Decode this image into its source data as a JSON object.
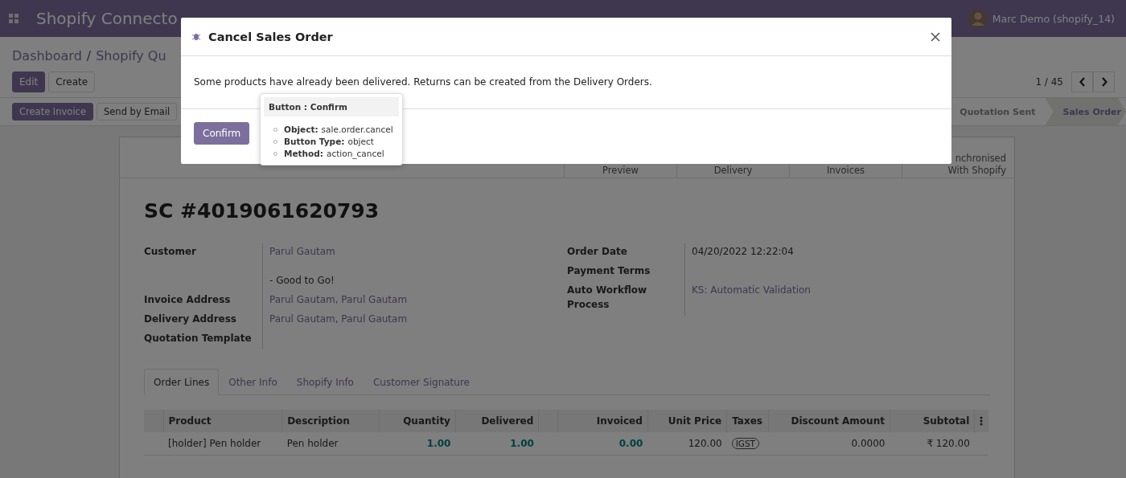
{
  "navbar": {
    "app_title": "Shopify Connecto",
    "user": "Marc Demo (shopify_14)"
  },
  "breadcrumb": {
    "separator": "/",
    "items": [
      {
        "label": "Dashboard"
      },
      {
        "label": "Shopify Qu"
      }
    ]
  },
  "control_buttons": [
    {
      "label": "Edit",
      "kind": "primary"
    },
    {
      "label": "Create",
      "kind": "secondary"
    }
  ],
  "pager": {
    "text": "1 / 45"
  },
  "action_buttons": [
    {
      "label": "Create Invoice",
      "kind": "primary"
    },
    {
      "label": "Send by Email",
      "kind": "secondary"
    }
  ],
  "status_steps": [
    {
      "label": "Quotation Sent",
      "selected": false
    },
    {
      "label": "Sales Order",
      "selected": true
    }
  ],
  "stat_buttons": [
    {
      "lines": [
        "Preview"
      ]
    },
    {
      "lines": [
        "Delivery"
      ]
    },
    {
      "lines": [
        "Invoices"
      ]
    },
    {
      "lines": [
        "nchronised",
        "With Shopify"
      ]
    }
  ],
  "record": {
    "title": "SC #4019061620793",
    "left_fields": [
      {
        "label": "Customer",
        "value": "Parul Gautam",
        "note": "- Good to Go!"
      },
      {
        "label": "Invoice Address",
        "value": "Parul Gautam, Parul Gautam"
      },
      {
        "label": "Delivery Address",
        "value": "Parul Gautam, Parul Gautam"
      },
      {
        "label": "Quotation Template"
      }
    ],
    "right_fields": [
      {
        "label": "Order Date",
        "value": "04/20/2022 12:22:04",
        "kind": "text"
      },
      {
        "label": "Payment Terms"
      },
      {
        "label": "Auto Workflow Process",
        "value": "KS: Automatic Validation",
        "kind": "link"
      }
    ]
  },
  "tabs": [
    {
      "label": "Order Lines",
      "selected": true
    },
    {
      "label": "Other Info",
      "selected": false
    },
    {
      "label": "Shopify Info",
      "selected": false
    },
    {
      "label": "Customer Signature",
      "selected": false
    }
  ],
  "table": {
    "columns": [
      {
        "kind": "handle"
      },
      {
        "label": "Product"
      },
      {
        "label": "Description"
      },
      {
        "label": "Quantity"
      },
      {
        "label": "Delivered"
      },
      {
        "kind": "blank"
      },
      {
        "label": "Invoiced"
      },
      {
        "label": "Unit Price"
      },
      {
        "label": "Taxes"
      },
      {
        "label": "Discount Amount"
      },
      {
        "label": "Subtotal"
      },
      {
        "kind": "menu"
      }
    ],
    "rows": [
      [
        {
          "kind": "blank"
        },
        {
          "text": "[holder] Pen holder",
          "kind": "text"
        },
        {
          "text": "Pen holder",
          "kind": "text"
        },
        {
          "text": "1.00",
          "kind": "number"
        },
        {
          "text": "1.00",
          "kind": "number"
        },
        {
          "kind": "blank"
        },
        {
          "text": "0.00",
          "kind": "number"
        },
        {
          "text": "120.00",
          "kind": "plain"
        },
        {
          "text": "IGST",
          "kind": "tag"
        },
        {
          "text": "0.0000",
          "kind": "plain"
        },
        {
          "text": "₹ 120.00",
          "kind": "plain"
        },
        {
          "kind": "blank"
        }
      ]
    ]
  },
  "modal": {
    "title": "Cancel Sales Order",
    "message": "Some products have already been delivered. Returns can be created from the Delivery Orders.",
    "button": "Confirm"
  },
  "tooltip": {
    "title": "Button : Confirm",
    "items": [
      {
        "key": "Object:",
        "value": "sale.order.cancel"
      },
      {
        "key": "Button Type:",
        "value": "object"
      },
      {
        "key": "Method:",
        "value": "action_cancel"
      }
    ]
  }
}
